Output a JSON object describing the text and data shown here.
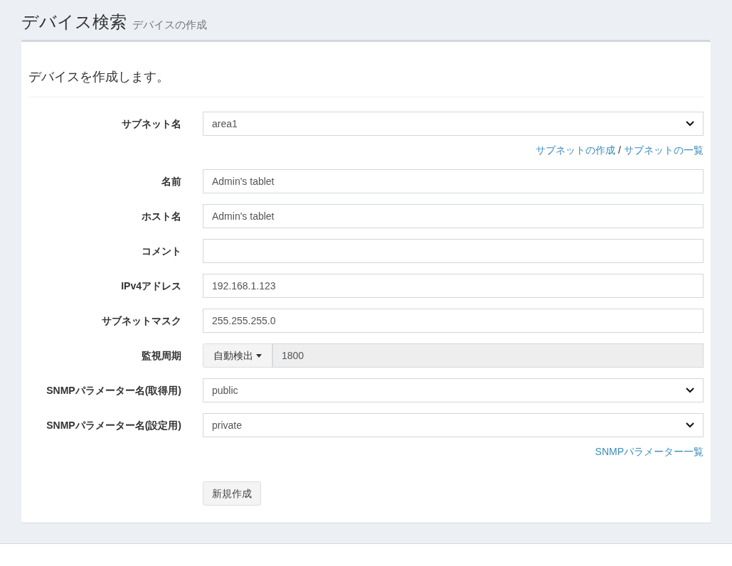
{
  "header": {
    "title": "デバイス検索",
    "subtitle": "デバイスの作成"
  },
  "card": {
    "intro": "デバイスを作成します。",
    "fields": [
      {
        "label": "サブネット名",
        "kind": "select",
        "value": "area1",
        "links": [
          "サブネットの作成",
          "サブネットの一覧"
        ],
        "separator": "/"
      },
      {
        "label": "名前",
        "kind": "text",
        "value": "Admin's tablet"
      },
      {
        "label": "ホスト名",
        "kind": "text",
        "value": "Admin's tablet"
      },
      {
        "label": "コメント",
        "kind": "text"
      },
      {
        "label": "IPv4アドレス",
        "kind": "text",
        "value": "192.168.1.123"
      },
      {
        "label": "サブネットマスク",
        "kind": "text",
        "value": "255.255.255.0"
      },
      {
        "label": "監視周期",
        "kind": "addon",
        "button": "自動検出",
        "value": "1800",
        "disabled": true
      },
      {
        "label": "SNMPパラメーター名(取得用)",
        "kind": "select",
        "value": "public"
      },
      {
        "label": "SNMPパラメーター名(設定用)",
        "kind": "select",
        "value": "private",
        "links": [
          "SNMPパラメーター一覧"
        ]
      }
    ],
    "submit": "新規作成"
  }
}
